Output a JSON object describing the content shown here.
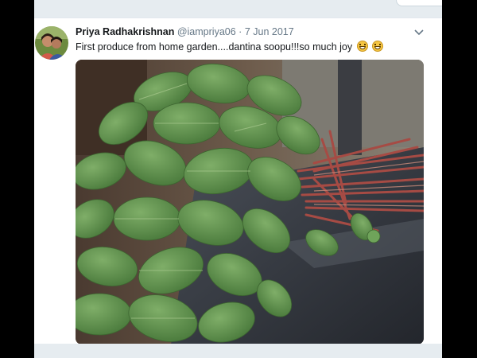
{
  "tweet": {
    "display_name": "Priya Radhakrishnan",
    "handle": "@iampriya06",
    "separator": "·",
    "date": "7 Jun 2017",
    "text": "First produce from home garden....dantina soopu!!!so much joy",
    "emojis": [
      "grinning-face-with-smiling-eyes",
      "grinning-face-with-smiling-eyes"
    ]
  },
  "colors": {
    "page_bg": "#e6ecf0",
    "tweet_bg": "#ffffff",
    "name": "#14171a",
    "muted": "#657786",
    "leaf": "#5e8f4e",
    "stem": "#a0453f",
    "table": "#3a3f47"
  },
  "icons": [
    "avatar",
    "chevron-down-icon"
  ]
}
